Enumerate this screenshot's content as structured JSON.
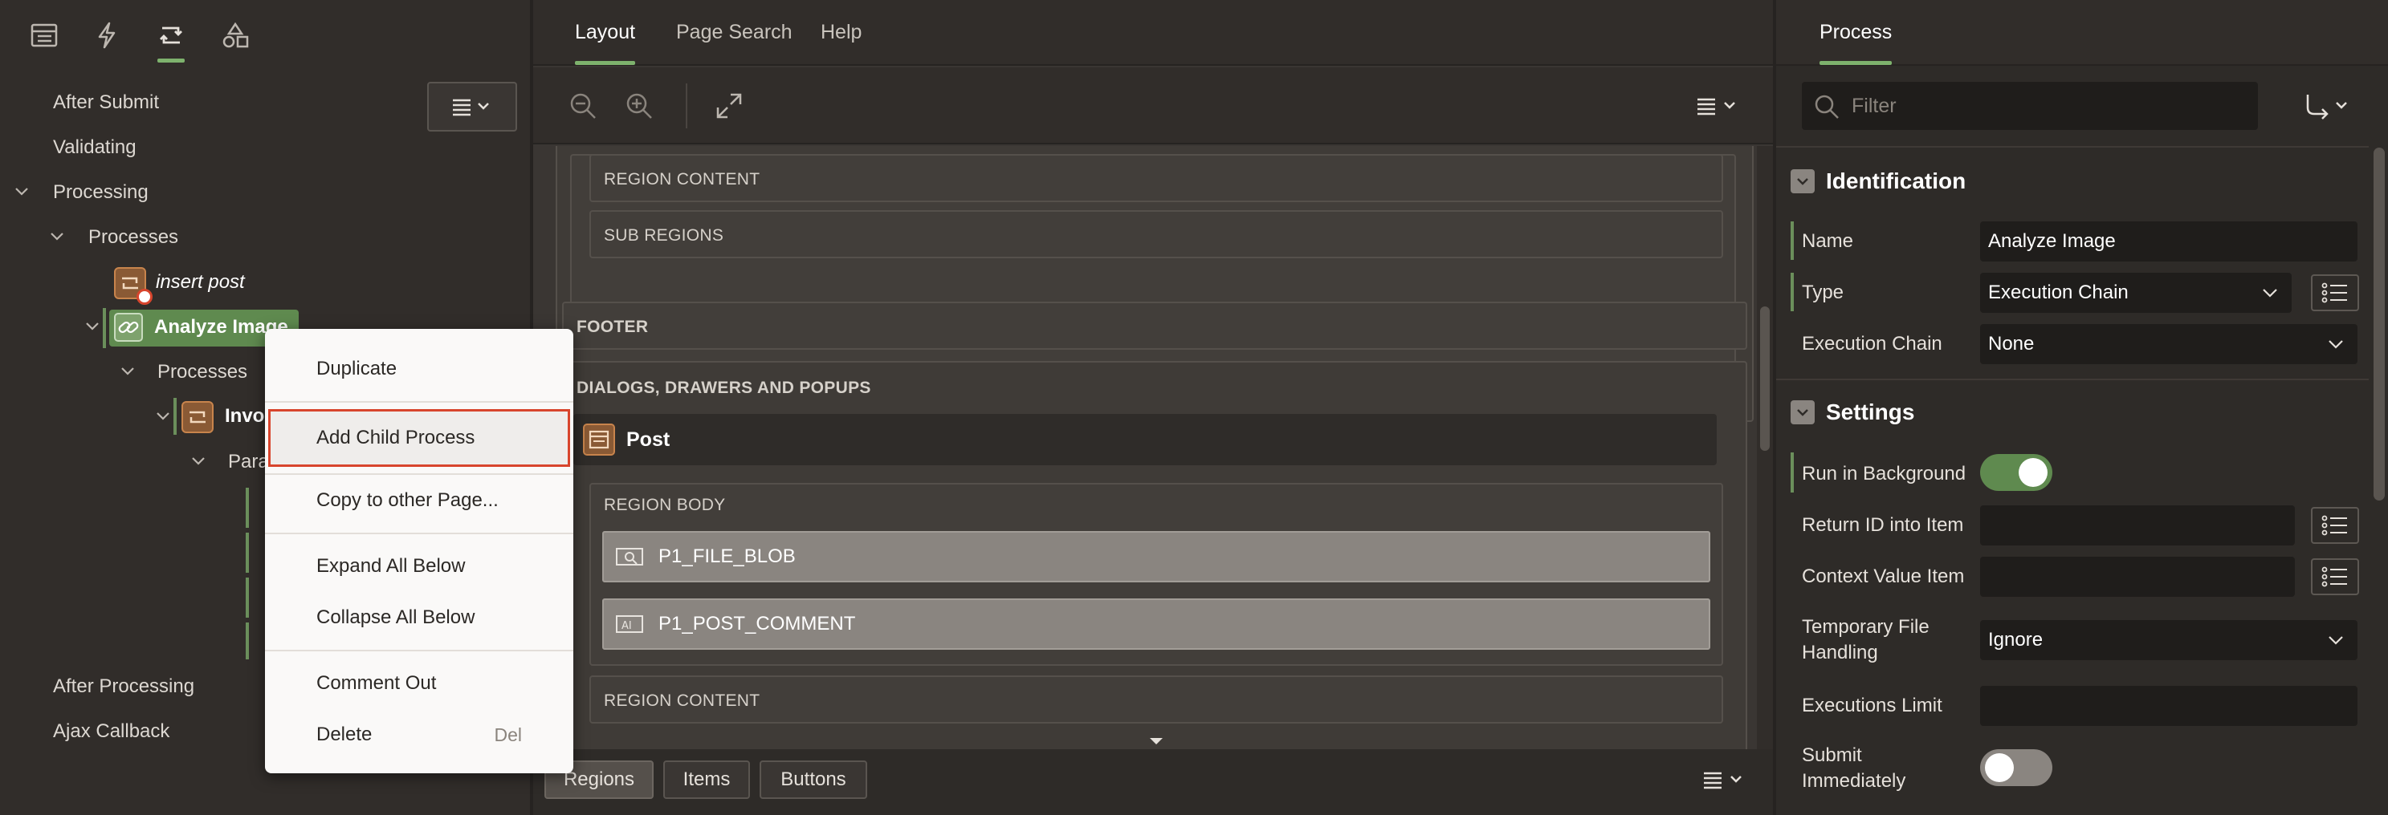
{
  "left_tabs": [
    "rendering-icon",
    "dynamic-actions-icon",
    "processing-icon",
    "shared-components-icon"
  ],
  "toolbar_menu_icon": "menu-lines-icon",
  "tree": {
    "after_submit": "After Submit",
    "validating": "Validating",
    "processing": "Processing",
    "processes": "Processes",
    "insert_post": "insert post",
    "analyze_image": "Analyze Image",
    "child_processes": "Processes",
    "invoke_partial": "Invo",
    "parameters_partial": "Para",
    "after_processing": "After Processing",
    "ajax_callback": "Ajax Callback"
  },
  "context_menu": {
    "duplicate": "Duplicate",
    "add_child_process": "Add Child Process",
    "copy_to_other_page": "Copy to other Page...",
    "expand_all_below": "Expand All Below",
    "collapse_all_below": "Collapse All Below",
    "comment_out": "Comment Out",
    "delete": "Delete",
    "delete_shortcut": "Del"
  },
  "center": {
    "tabs": [
      "Layout",
      "Page Search",
      "Help"
    ],
    "active_tab": "Layout",
    "region_content_top": "REGION CONTENT",
    "sub_regions": "SUB REGIONS",
    "footer": "FOOTER",
    "dialogs": "DIALOGS, DRAWERS AND POPUPS",
    "post_region": "Post",
    "region_body": "REGION BODY",
    "item1": "P1_FILE_BLOB",
    "item2": "P1_POST_COMMENT",
    "region_content_bottom": "REGION CONTENT",
    "bottom_tabs": [
      "Regions",
      "Items",
      "Buttons"
    ]
  },
  "right": {
    "tab": "Process",
    "filter_placeholder": "Filter",
    "identification": "Identification",
    "name_label": "Name",
    "name_value": "Analyze Image",
    "type_label": "Type",
    "type_value": "Execution Chain",
    "execution_chain_label": "Execution Chain",
    "execution_chain_value": "None",
    "settings": "Settings",
    "run_in_background_label": "Run in Background",
    "run_in_background": true,
    "return_id_label": "Return ID into Item",
    "return_id_value": "",
    "context_value_label": "Context Value Item",
    "context_value_value": "",
    "temp_file_label_1": "Temporary File",
    "temp_file_label_2": "Handling",
    "temp_file_value": "Ignore",
    "executions_limit_label": "Executions Limit",
    "executions_limit_value": "",
    "submit_immediately_label_1": "Submit",
    "submit_immediately_label_2": "Immediately",
    "submit_immediately": false
  },
  "colors": {
    "accent_green": "#7eb26d",
    "highlight_red": "#d8452d",
    "toggle_on": "#5f8a4f",
    "toggle_off": "#8a8580"
  }
}
